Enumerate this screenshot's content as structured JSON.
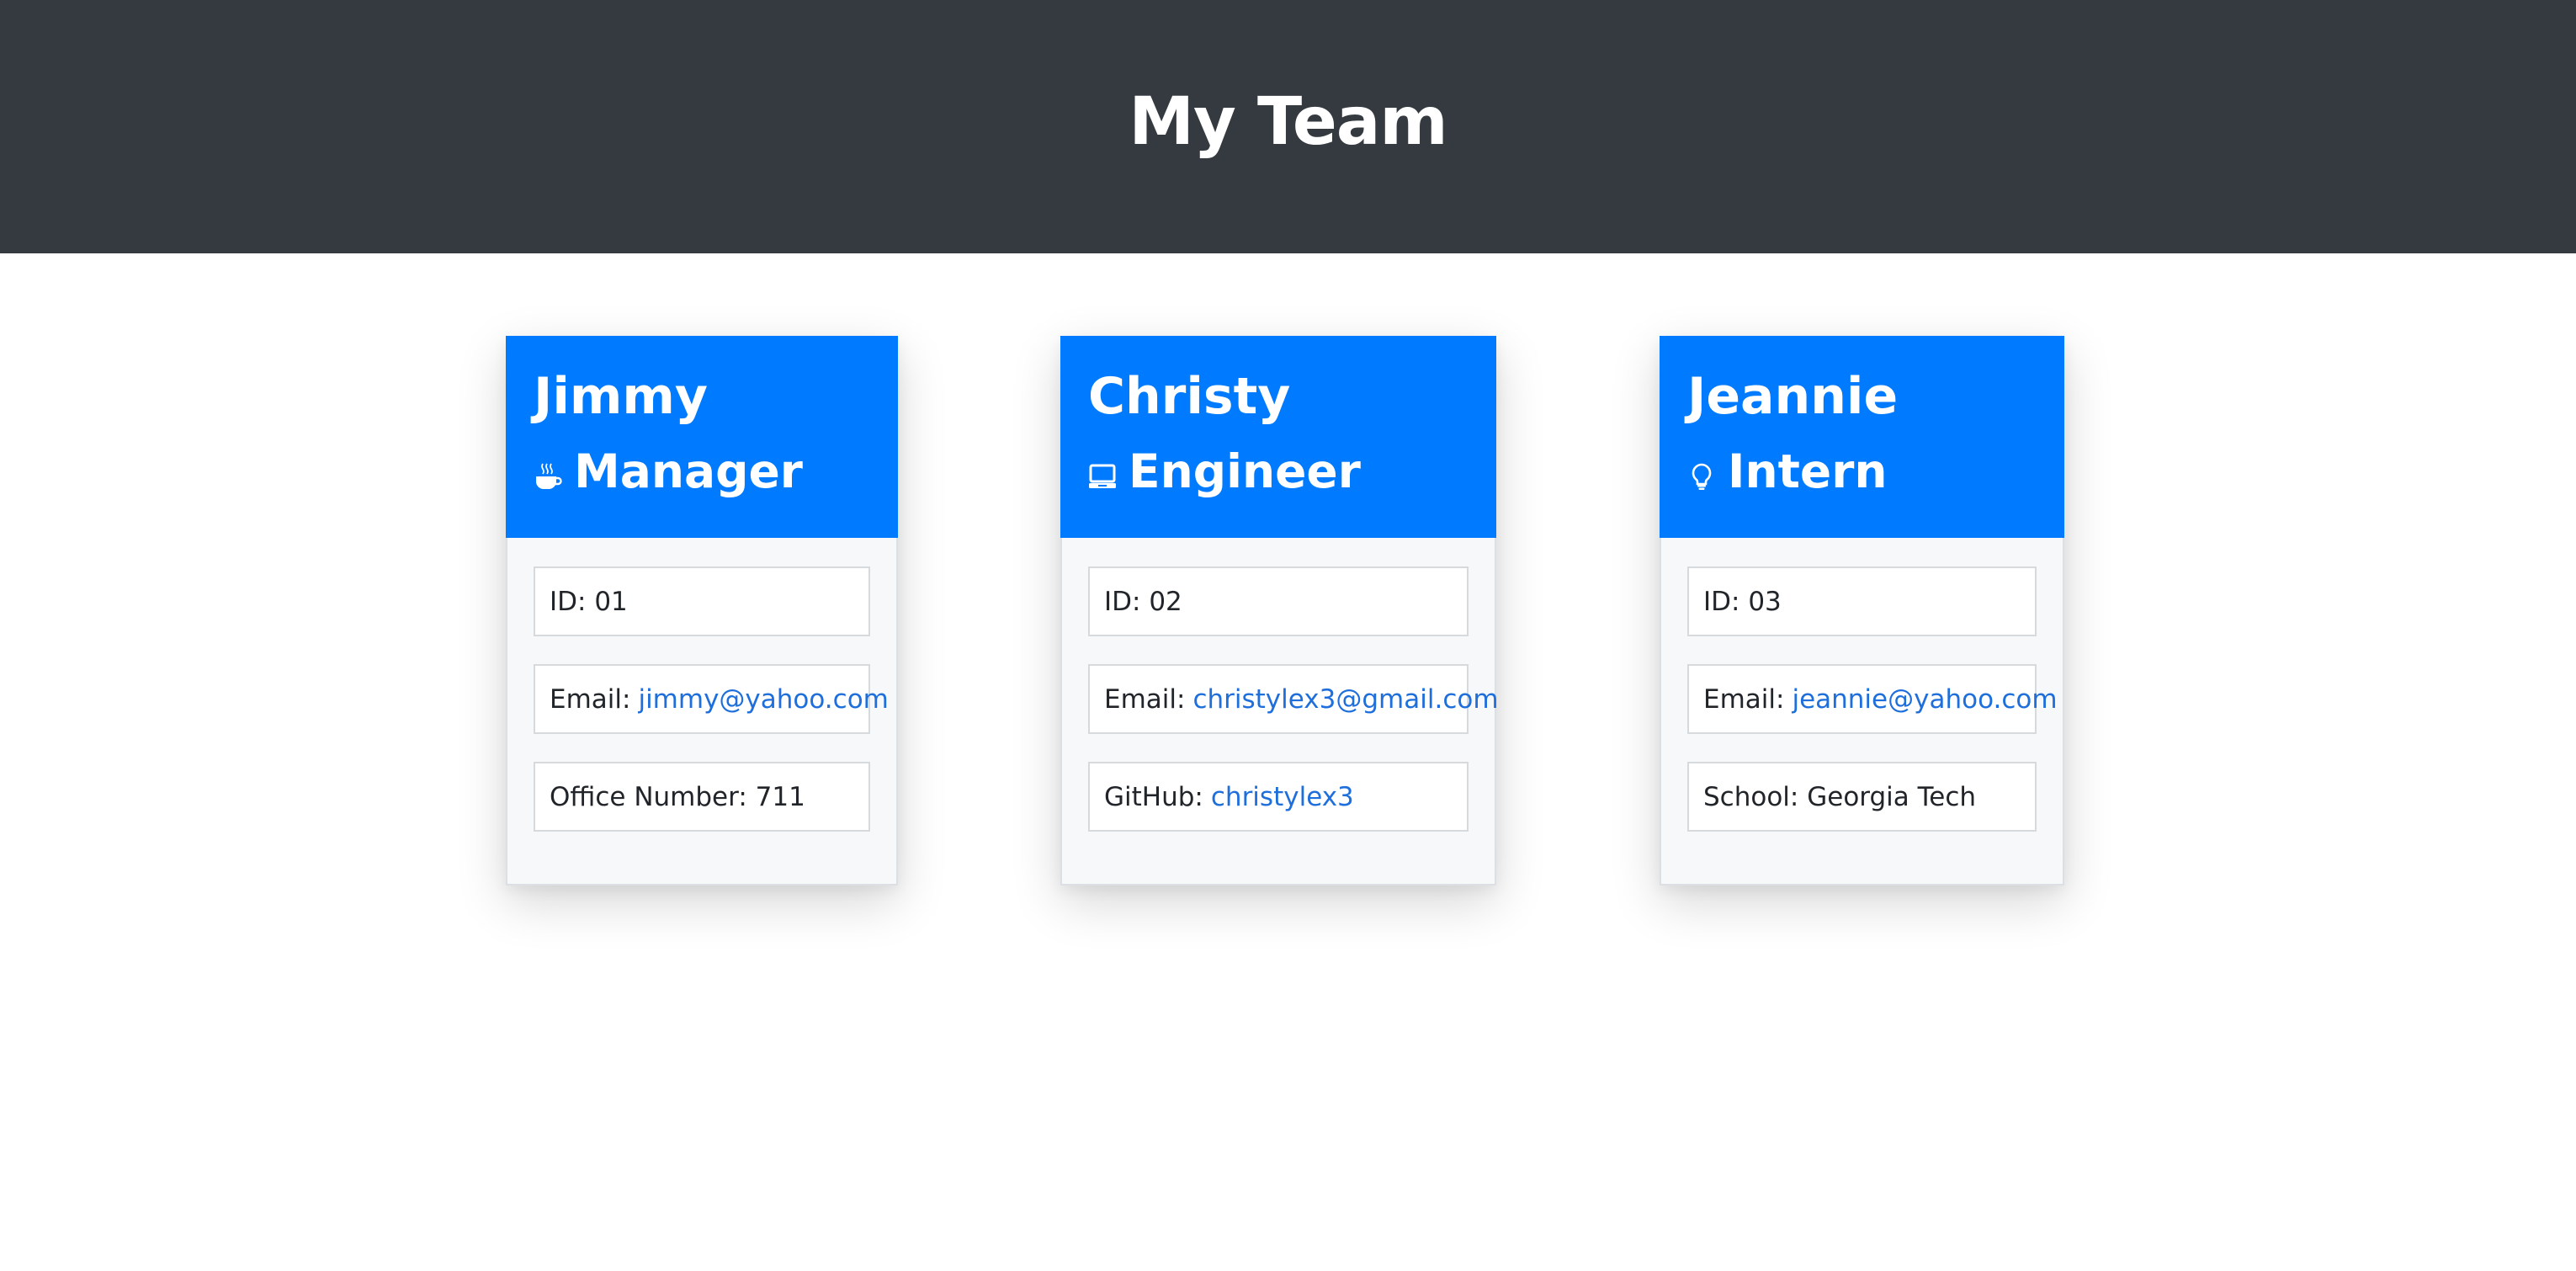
{
  "header": {
    "title": "My Team"
  },
  "team": [
    {
      "name": "Jimmy",
      "role": "Manager",
      "role_icon": "coffee-icon",
      "id_label": "ID:",
      "id": "01",
      "email_label": "Email:",
      "email": "jimmy@yahoo.com",
      "extra_label": "Office Number:",
      "extra_value": "711"
    },
    {
      "name": "Christy",
      "role": "Engineer",
      "role_icon": "laptop-icon",
      "id_label": "ID:",
      "id": "02",
      "email_label": "Email:",
      "email": "christylex3@gmail.com",
      "extra_label": "GitHub:",
      "extra_value": "christylex3"
    },
    {
      "name": "Jeannie",
      "role": "Intern",
      "role_icon": "lightbulb-icon",
      "id_label": "ID:",
      "id": "03",
      "email_label": "Email:",
      "email": "jeannie@yahoo.com",
      "extra_label": "School:",
      "extra_value": "Georgia Tech"
    }
  ],
  "colors": {
    "header_bg": "#343a40",
    "card_head_bg": "#007bff",
    "card_body_bg": "#f7f8f9",
    "link": "#1e6fdc"
  }
}
